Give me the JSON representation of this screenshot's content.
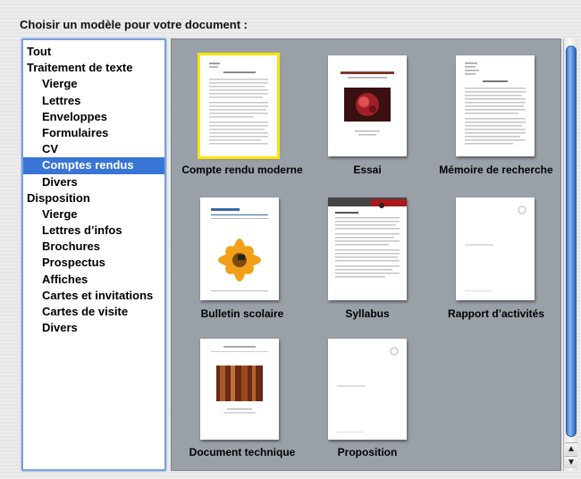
{
  "heading": "Choisir un modèle pour votre document :",
  "sidebar": {
    "items": [
      {
        "label": "Tout",
        "level": 0,
        "selected": false
      },
      {
        "label": "Traitement de texte",
        "level": 0,
        "selected": false
      },
      {
        "label": "Vierge",
        "level": 1,
        "selected": false
      },
      {
        "label": "Lettres",
        "level": 1,
        "selected": false
      },
      {
        "label": "Enveloppes",
        "level": 1,
        "selected": false
      },
      {
        "label": "Formulaires",
        "level": 1,
        "selected": false
      },
      {
        "label": "CV",
        "level": 1,
        "selected": false
      },
      {
        "label": "Comptes rendus",
        "level": 1,
        "selected": true
      },
      {
        "label": "Divers",
        "level": 1,
        "selected": false
      },
      {
        "label": "Disposition",
        "level": 0,
        "selected": false
      },
      {
        "label": "Vierge",
        "level": 1,
        "selected": false
      },
      {
        "label": "Lettres d’infos",
        "level": 1,
        "selected": false
      },
      {
        "label": "Brochures",
        "level": 1,
        "selected": false
      },
      {
        "label": "Prospectus",
        "level": 1,
        "selected": false
      },
      {
        "label": "Affiches",
        "level": 1,
        "selected": false
      },
      {
        "label": "Cartes et invitations",
        "level": 1,
        "selected": false
      },
      {
        "label": "Cartes de visite",
        "level": 1,
        "selected": false
      },
      {
        "label": "Divers",
        "level": 1,
        "selected": false
      }
    ]
  },
  "templates": [
    {
      "caption": "Compte rendu moderne",
      "selected": true
    },
    {
      "caption": "Essai",
      "selected": false
    },
    {
      "caption": "Mémoire de recherche",
      "selected": false
    },
    {
      "caption": "Bulletin scolaire",
      "selected": false
    },
    {
      "caption": "Syllabus",
      "selected": false
    },
    {
      "caption": "Rapport d’activités",
      "selected": false
    },
    {
      "caption": "Document technique",
      "selected": false
    },
    {
      "caption": "Proposition",
      "selected": false
    }
  ],
  "scrollbar": {
    "up_arrow": "▲",
    "down_arrow": "▼"
  },
  "colors": {
    "selection": "#3875d7",
    "selected_thumb_border": "#ffe300",
    "gallery_bg": "#9aa0a8"
  }
}
